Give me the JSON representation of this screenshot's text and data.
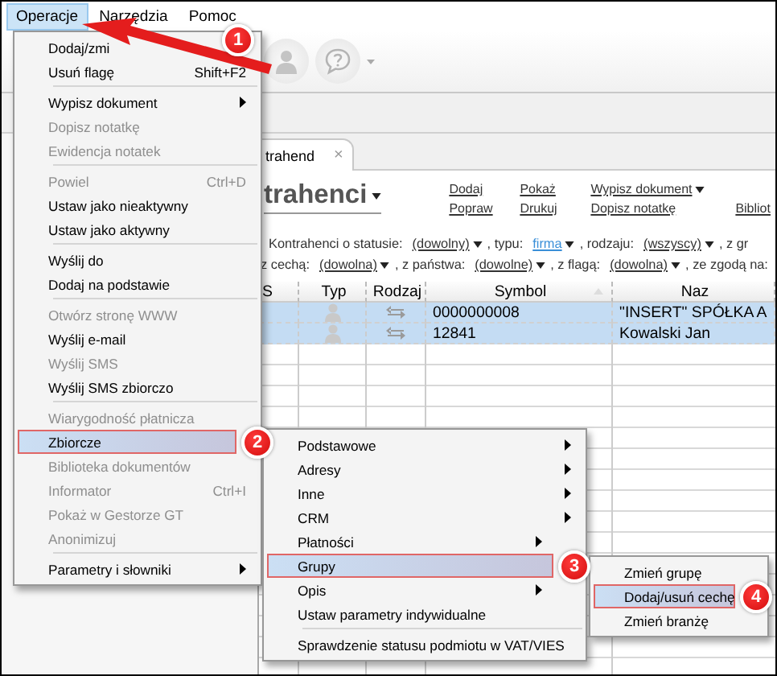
{
  "menu_bar": [
    {
      "label": "Operacje",
      "selected": true,
      "callout": "1"
    },
    {
      "label": "Narzędzia",
      "selected": false
    },
    {
      "label": "Pomoc",
      "selected": false
    }
  ],
  "tab": {
    "label": "trahend",
    "close": "×"
  },
  "heading": "trahenci",
  "action_rows": [
    [
      {
        "label": "Dodaj",
        "dropdown": false
      },
      {
        "label": "Pokaż",
        "dropdown": false
      },
      {
        "label": "Wypisz dokument",
        "dropdown": true
      }
    ],
    [
      {
        "label": "Popraw",
        "dropdown": false
      },
      {
        "label": "Drukuj",
        "dropdown": false
      },
      {
        "label": "Dopisz notatkę",
        "dropdown": false
      },
      {
        "label": "Bibliot",
        "dropdown": false
      }
    ]
  ],
  "filter_rows": [
    [
      {
        "kind": "text",
        "label": "Kontrahenci o statusie:"
      },
      {
        "kind": "choice",
        "label": "(dowolny)",
        "changed": false
      },
      {
        "kind": "text",
        "label": ", typu:"
      },
      {
        "kind": "choice",
        "label": "firma",
        "changed": true
      },
      {
        "kind": "text",
        "label": ", rodzaju:"
      },
      {
        "kind": "choice",
        "label": "(wszyscy)",
        "changed": false
      },
      {
        "kind": "text",
        "label": ", z gr"
      }
    ],
    [
      {
        "kind": "text",
        "label": "z cechą:"
      },
      {
        "kind": "choice",
        "label": "(dowolna)",
        "changed": false
      },
      {
        "kind": "text",
        "label": ", z państwa:"
      },
      {
        "kind": "choice",
        "label": "(dowolne)",
        "changed": false
      },
      {
        "kind": "text",
        "label": ", z flagą:"
      },
      {
        "kind": "choice",
        "label": "(dowolna)",
        "changed": false
      },
      {
        "kind": "text",
        "label": ", ze zgodą na:"
      }
    ]
  ],
  "table": {
    "columns": [
      {
        "label": "S",
        "sorted": false
      },
      {
        "label": "Typ",
        "sorted": false
      },
      {
        "label": "Rodzaj",
        "sorted": false
      },
      {
        "label": "Symbol",
        "sorted": true
      },
      {
        "label": "Naz",
        "sorted": false
      }
    ],
    "rows": [
      {
        "symbol": "0000000008",
        "name": "\"INSERT\" SPÓŁKA A",
        "selected": true
      },
      {
        "symbol": "12841",
        "name": "Kowalski Jan",
        "selected": true
      }
    ]
  },
  "menu": {
    "items": [
      {
        "kind": "item",
        "label": "Dodaj/zmi",
        "disabled": false,
        "selected": false
      },
      {
        "kind": "item",
        "label": "Usuń flagę",
        "shortcut": "Shift+F2",
        "disabled": false,
        "submenu": false,
        "selected": false
      },
      {
        "kind": "separator"
      },
      {
        "kind": "item",
        "label": "Wypisz dokument",
        "disabled": false,
        "submenu": true,
        "selected": false
      },
      {
        "kind": "item",
        "label": "Dopisz notatkę",
        "disabled": true,
        "submenu": false,
        "selected": false
      },
      {
        "kind": "item",
        "label": "Ewidencja notatek",
        "disabled": true,
        "submenu": false,
        "selected": false
      },
      {
        "kind": "separator"
      },
      {
        "kind": "item",
        "label": "Powiel",
        "shortcut": "Ctrl+D",
        "disabled": true,
        "submenu": false,
        "selected": false
      },
      {
        "kind": "item",
        "label": "Ustaw jako nieaktywny",
        "disabled": false,
        "submenu": false,
        "selected": false
      },
      {
        "kind": "item",
        "label": "Ustaw jako aktywny",
        "disabled": false,
        "submenu": false,
        "selected": false
      },
      {
        "kind": "separator"
      },
      {
        "kind": "item",
        "label": "Wyślij do",
        "disabled": false,
        "submenu": false,
        "selected": false
      },
      {
        "kind": "item",
        "label": "Dodaj na podstawie",
        "disabled": false,
        "submenu": false,
        "selected": false
      },
      {
        "kind": "separator"
      },
      {
        "kind": "item",
        "label": "Otwórz stronę WWW",
        "disabled": true,
        "submenu": false,
        "selected": false
      },
      {
        "kind": "item",
        "label": "Wyślij e-mail",
        "disabled": false,
        "submenu": false,
        "selected": false
      },
      {
        "kind": "item",
        "label": "Wyślij SMS",
        "disabled": true,
        "submenu": false,
        "selected": false
      },
      {
        "kind": "item",
        "label": "Wyślij SMS zbiorczo",
        "disabled": false,
        "submenu": false,
        "selected": false
      },
      {
        "kind": "separator"
      },
      {
        "kind": "item",
        "label": "Wiarygodność płatnicza",
        "disabled": true,
        "submenu": false,
        "selected": false
      },
      {
        "kind": "item",
        "label": "Zbiorcze",
        "disabled": false,
        "submenu": false,
        "selected": true,
        "callout": "2",
        "children": [
          {
            "kind": "item",
            "label": "Podstawowe",
            "disabled": false,
            "submenu": true,
            "selected": false
          },
          {
            "kind": "item",
            "label": "Adresy",
            "disabled": false,
            "submenu": true,
            "selected": false
          },
          {
            "kind": "item",
            "label": "Inne",
            "disabled": false,
            "submenu": true,
            "selected": false
          },
          {
            "kind": "item",
            "label": "CRM",
            "disabled": false,
            "submenu": true,
            "selected": false
          },
          {
            "kind": "item",
            "label": "Płatności",
            "disabled": false,
            "submenu": true,
            "selected": false
          },
          {
            "kind": "item",
            "label": "Grupy",
            "disabled": false,
            "submenu": false,
            "selected": true,
            "callout": "3",
            "children": [
              {
                "kind": "item",
                "label": "Zmień grupę",
                "disabled": false,
                "submenu": false,
                "selected": false
              },
              {
                "kind": "item",
                "label": "Dodaj/usuń cechę",
                "disabled": false,
                "submenu": false,
                "selected": true,
                "callout": "4"
              },
              {
                "kind": "item",
                "label": "Zmień branżę",
                "disabled": false,
                "submenu": false,
                "selected": false
              }
            ]
          },
          {
            "kind": "item",
            "label": "Opis",
            "disabled": false,
            "submenu": true,
            "selected": false
          },
          {
            "kind": "item",
            "label": "Ustaw parametry indywidualne",
            "disabled": false,
            "submenu": false,
            "selected": false
          },
          {
            "kind": "separator"
          },
          {
            "kind": "item",
            "label": "Sprawdzenie statusu podmiotu w VAT/VIES",
            "disabled": false,
            "submenu": false,
            "selected": false
          }
        ]
      },
      {
        "kind": "item",
        "label": "Biblioteka dokumentów",
        "disabled": true,
        "submenu": false,
        "selected": false
      },
      {
        "kind": "item",
        "label": "Informator",
        "shortcut": "Ctrl+I",
        "disabled": true,
        "submenu": false,
        "selected": false
      },
      {
        "kind": "item",
        "label": "Pokaż w Gestorze GT",
        "disabled": true,
        "submenu": false,
        "selected": false
      },
      {
        "kind": "item",
        "label": "Anonimizuj",
        "disabled": true,
        "submenu": false,
        "selected": false
      },
      {
        "kind": "separator"
      },
      {
        "kind": "item",
        "label": "Parametry i słowniki",
        "disabled": false,
        "submenu": true,
        "selected": false
      }
    ]
  }
}
